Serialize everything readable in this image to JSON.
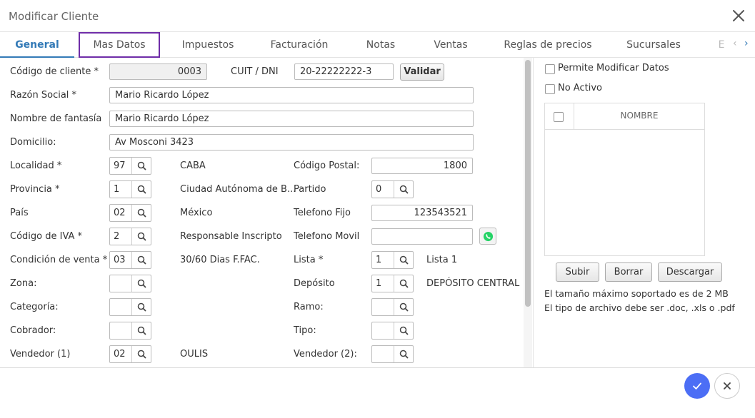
{
  "window": {
    "title": "Modificar Cliente"
  },
  "tabs": [
    {
      "label": "General"
    },
    {
      "label": "Mas Datos"
    },
    {
      "label": "Impuestos"
    },
    {
      "label": "Facturación"
    },
    {
      "label": "Notas"
    },
    {
      "label": "Ventas"
    },
    {
      "label": "Reglas de precios"
    },
    {
      "label": "Sucursales"
    },
    {
      "label": "E"
    }
  ],
  "form": {
    "codigo_cliente": {
      "label": "Código de cliente *",
      "value": "0003"
    },
    "cuit": {
      "label": "CUIT / DNI",
      "value": "20-22222222-3",
      "validar": "Validar"
    },
    "razon_social": {
      "label": "Razón Social *",
      "value": "Mario Ricardo López"
    },
    "nombre_fantasia": {
      "label": "Nombre de fantasía",
      "value": "Mario Ricardo López"
    },
    "domicilio": {
      "label": "Domicilio:",
      "value": "Av Mosconi 3423"
    },
    "localidad": {
      "label": "Localidad *",
      "code": "97",
      "desc": "CABA"
    },
    "codigo_postal": {
      "label": "Código Postal:",
      "value": "1800"
    },
    "provincia": {
      "label": "Provincia *",
      "code": "1",
      "desc": "Ciudad Autónoma de B..."
    },
    "partido": {
      "label": "Partido",
      "code": "0"
    },
    "pais": {
      "label": "País",
      "code": "02",
      "desc": "México"
    },
    "telefono_fijo": {
      "label": "Telefono Fijo",
      "value": "123543521"
    },
    "codigo_iva": {
      "label": "Código de IVA *",
      "code": "2",
      "desc": "Responsable Inscripto"
    },
    "telefono_movil": {
      "label": "Telefono Movil",
      "value": ""
    },
    "condicion_venta": {
      "label": "Condición de venta *",
      "code": "03",
      "desc": "30/60 Dias F.FAC."
    },
    "lista": {
      "label": "Lista *",
      "code": "1",
      "desc": "Lista 1"
    },
    "zona": {
      "label": "Zona:",
      "code": ""
    },
    "deposito": {
      "label": "Depósito",
      "code": "1",
      "desc": "DEPÓSITO CENTRAL"
    },
    "categoria": {
      "label": "Categoría:",
      "code": ""
    },
    "ramo": {
      "label": "Ramo:",
      "code": ""
    },
    "cobrador": {
      "label": "Cobrador:",
      "code": ""
    },
    "tipo": {
      "label": "Tipo:",
      "code": ""
    },
    "vendedor1": {
      "label": "Vendedor (1)",
      "code": "02",
      "desc": "OULIS"
    },
    "vendedor2": {
      "label": "Vendedor (2):",
      "code": ""
    }
  },
  "side": {
    "permite_modificar": "Permite Modificar Datos",
    "no_activo": "No Activo",
    "grid_header": "NOMBRE",
    "subir": "Subir",
    "borrar": "Borrar",
    "descargar": "Descargar",
    "info1": "El tamaño máximo soportado es de 2 MB",
    "info2": "El tipo de archivo debe ser .doc, .xls o .pdf"
  },
  "colors": {
    "accent": "#337ab7",
    "focus": "#6f2da8",
    "ok": "#4c6ef5",
    "whatsapp": "#25d366"
  },
  "icons": {
    "close": "close-icon",
    "search": "search-icon",
    "whatsapp": "whatsapp-icon",
    "ok": "check-icon",
    "cancel": "close-icon"
  }
}
